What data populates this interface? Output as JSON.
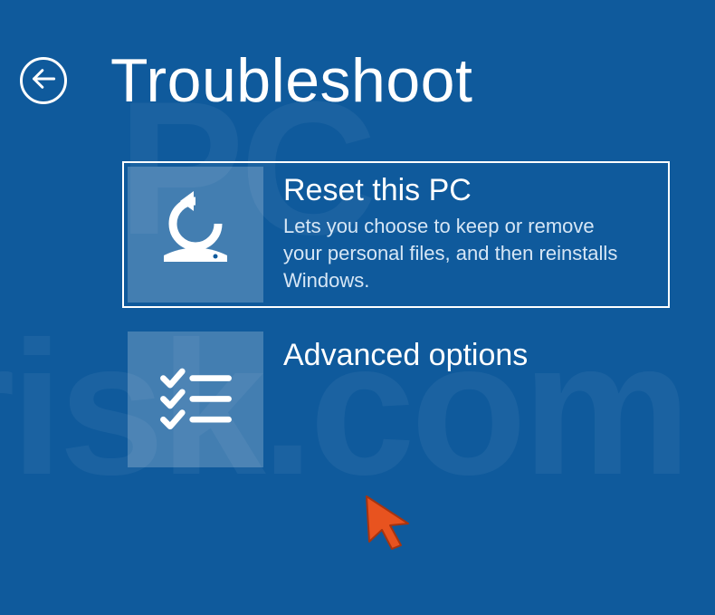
{
  "header": {
    "title": "Troubleshoot"
  },
  "options": [
    {
      "title": "Reset this PC",
      "description": "Lets you choose to keep or remove your personal files, and then reinstalls Windows.",
      "selected": true
    },
    {
      "title": "Advanced options",
      "description": "",
      "selected": false
    }
  ],
  "watermark": {
    "line1": "PC",
    "line2": "risk.com"
  }
}
